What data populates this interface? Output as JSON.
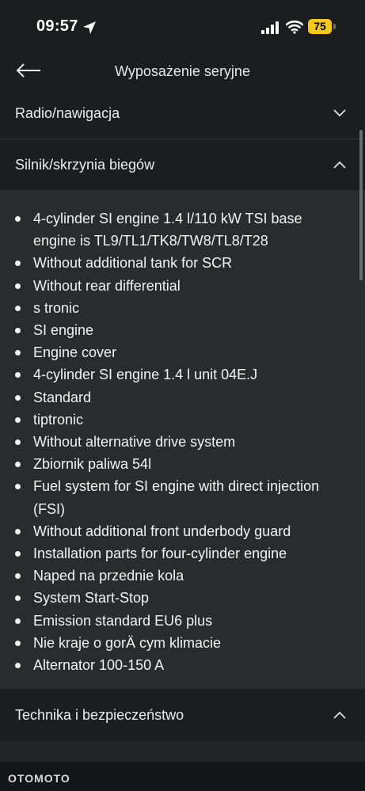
{
  "status_bar": {
    "time": "09:57",
    "battery": "75"
  },
  "header": {
    "title": "Wyposażenie seryjne"
  },
  "sections": {
    "radio": "Radio/nawigacja",
    "engine": "Silnik/skrzynia biegów",
    "tech": "Technika i bezpieczeństwo"
  },
  "engine_items": [
    "4-cylinder SI engine 1.4 l/110 kW TSI base engine is TL9/TL1/TK8/TW8/TL8/T28",
    "Without additional tank for SCR",
    "Without rear differential",
    "s tronic",
    "SI engine",
    "Engine cover",
    "4-cylinder SI engine 1.4 l unit 04E.J",
    "Standard",
    "tiptronic",
    "Without alternative drive system",
    "Zbiornik paliwa 54l",
    "Fuel system for SI engine with direct injection (FSI)",
    "Without additional front underbody guard",
    "Installation parts for four-cylinder engine",
    "Naped na przednie kola",
    "System Start-Stop",
    "Emission standard EU6 plus",
    "Nie kraje o gorÄ cym klimacie",
    "Alternator 100-150 A"
  ],
  "watermark": "OTOMOTO"
}
